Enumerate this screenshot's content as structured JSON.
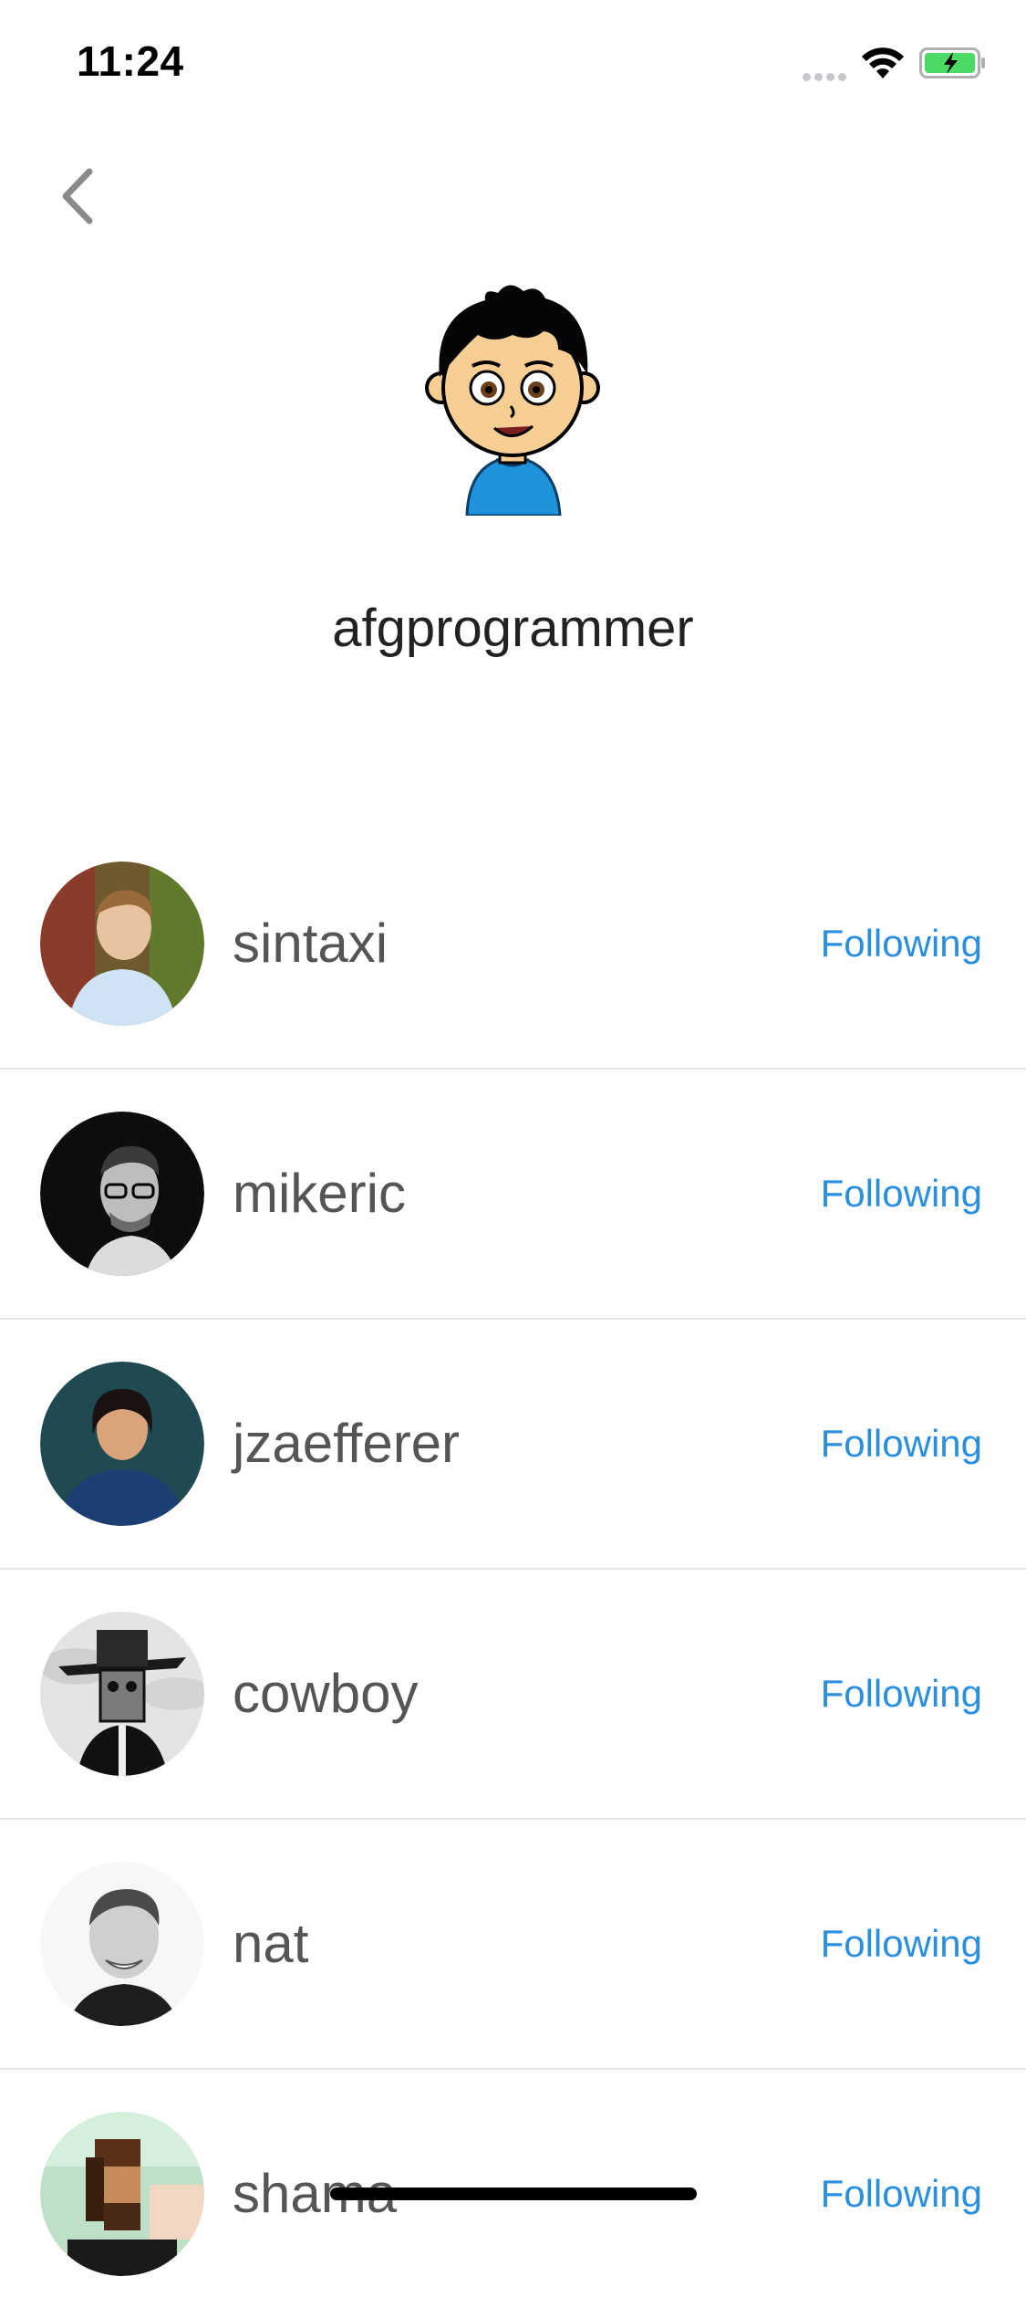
{
  "status_bar": {
    "time": "11:24"
  },
  "profile": {
    "name": "afgprogrammer",
    "avatar_icon": "cartoon-boy-avatar"
  },
  "accent_color": "#2b8fe0",
  "following": [
    {
      "username": "sintaxi",
      "action": "Following",
      "avatar": "avatar-sintaxi"
    },
    {
      "username": "mikeric",
      "action": "Following",
      "avatar": "avatar-mikeric"
    },
    {
      "username": "jzaefferer",
      "action": "Following",
      "avatar": "avatar-jzaefferer"
    },
    {
      "username": "cowboy",
      "action": "Following",
      "avatar": "avatar-cowboy"
    },
    {
      "username": "nat",
      "action": "Following",
      "avatar": "avatar-nat"
    },
    {
      "username": "shama",
      "action": "Following",
      "avatar": "avatar-shama"
    }
  ]
}
